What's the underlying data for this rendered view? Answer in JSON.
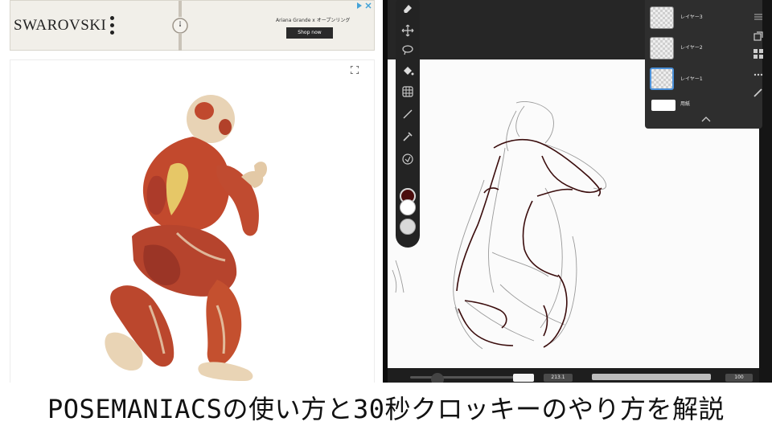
{
  "ad": {
    "brand": "SWAROVSKI",
    "copy": "Ariana Grande x オープンリング",
    "cta": "Shop now"
  },
  "layers": [
    {
      "name": "レイヤー3"
    },
    {
      "name": "レイヤー2"
    },
    {
      "name": "レイヤー1"
    },
    {
      "name": "用紙"
    }
  ],
  "brush": {
    "size_value": "213.1",
    "opacity_value": "100"
  },
  "swatches": {
    "primary": "#4a0d0d",
    "secondary": "#ffffff",
    "tertiary": "#d9d9d9"
  },
  "caption": "POSEMANIACSの使い方と30秒クロッキーのやり方を解説"
}
